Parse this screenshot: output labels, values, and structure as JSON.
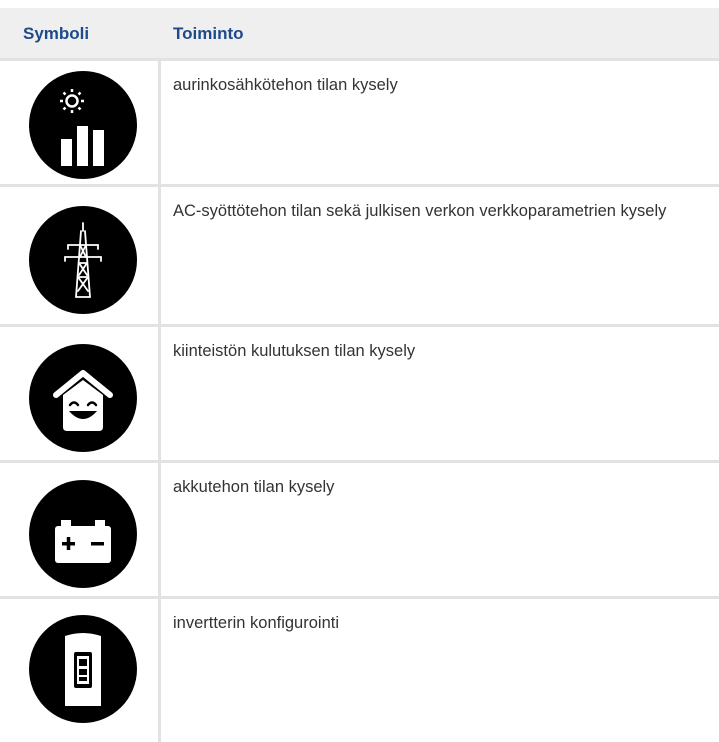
{
  "header": {
    "col_symbol": "Symboli",
    "col_function": "Toiminto"
  },
  "rows": [
    {
      "icon": "solar-power-icon",
      "text": "aurinkosähkötehon tilan kysely"
    },
    {
      "icon": "power-pylon-icon",
      "text": "AC-syöttötehon tilan sekä julkisen verkon verkkoparametrien kysely"
    },
    {
      "icon": "house-consumption-icon",
      "text": "kiinteistön kulutuksen tilan kysely"
    },
    {
      "icon": "battery-icon",
      "text": "akkutehon tilan kysely"
    },
    {
      "icon": "inverter-icon",
      "text": "invertterin konfigurointi"
    }
  ]
}
